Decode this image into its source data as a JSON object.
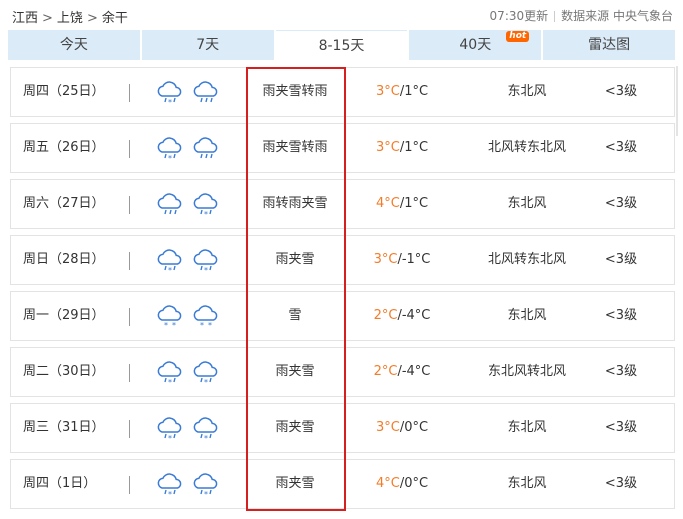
{
  "breadcrumb": [
    "江西",
    "上饶",
    "余干"
  ],
  "breadcrumb_sep": ">",
  "meta": {
    "update": "07:30更新",
    "source_label": "数据来源",
    "source": "中央气象台"
  },
  "tabs": [
    {
      "label": "今天"
    },
    {
      "label": "7天"
    },
    {
      "label": "8-15天",
      "active": true
    },
    {
      "label": "40天",
      "badge": "hot"
    },
    {
      "label": "雷达图"
    }
  ],
  "rows": [
    {
      "day": "周四（25日）",
      "icons": [
        "rain-snow-icon",
        "rain-icon"
      ],
      "desc": "雨夹雪转雨",
      "hi": "3°C",
      "lo": "/1°C",
      "wind": "东北风",
      "level": "<3级"
    },
    {
      "day": "周五（26日）",
      "icons": [
        "rain-snow-icon",
        "rain-icon"
      ],
      "desc": "雨夹雪转雨",
      "hi": "3°C",
      "lo": "/1°C",
      "wind": "北风转东北风",
      "level": "<3级"
    },
    {
      "day": "周六（27日）",
      "icons": [
        "rain-icon",
        "rain-snow-icon"
      ],
      "desc": "雨转雨夹雪",
      "hi": "4°C",
      "lo": "/1°C",
      "wind": "东北风",
      "level": "<3级"
    },
    {
      "day": "周日（28日）",
      "icons": [
        "rain-snow-icon",
        "rain-snow-icon"
      ],
      "desc": "雨夹雪",
      "hi": "3°C",
      "lo": "/-1°C",
      "wind": "北风转东北风",
      "level": "<3级"
    },
    {
      "day": "周一（29日）",
      "icons": [
        "snow-icon",
        "snow-icon"
      ],
      "desc": "雪",
      "hi": "2°C",
      "lo": "/-4°C",
      "wind": "东北风",
      "level": "<3级"
    },
    {
      "day": "周二（30日）",
      "icons": [
        "rain-snow-icon",
        "rain-snow-icon"
      ],
      "desc": "雨夹雪",
      "hi": "2°C",
      "lo": "/-4°C",
      "wind": "东北风转北风",
      "level": "<3级"
    },
    {
      "day": "周三（31日）",
      "icons": [
        "rain-snow-icon",
        "rain-snow-icon"
      ],
      "desc": "雨夹雪",
      "hi": "3°C",
      "lo": "/0°C",
      "wind": "东北风",
      "level": "<3级"
    },
    {
      "day": "周四（1日）",
      "icons": [
        "rain-snow-icon",
        "rain-snow-icon"
      ],
      "desc": "雨夹雪",
      "hi": "4°C",
      "lo": "/0°C",
      "wind": "东北风",
      "level": "<3级"
    }
  ],
  "colors": {
    "tab_bg": "#dcebf8",
    "high_temp": "#f27c2a",
    "icon": "#3a7bd5",
    "highlight": "#d61f1f"
  }
}
